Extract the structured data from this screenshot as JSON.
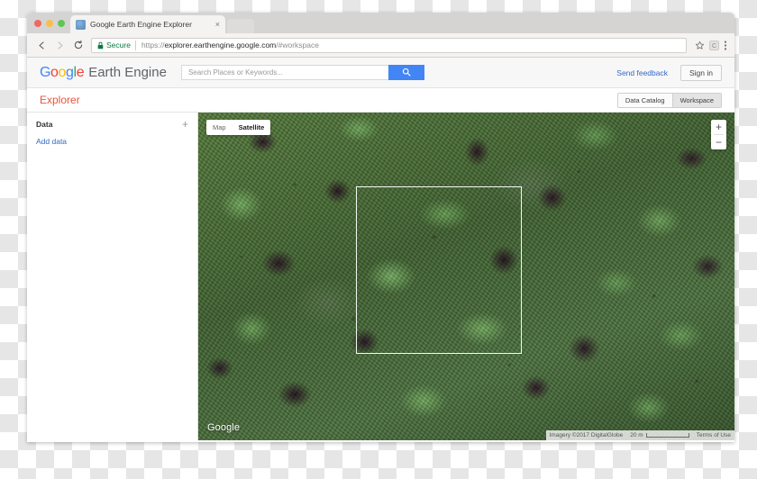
{
  "browser": {
    "tab": {
      "title": "Google Earth Engine Explorer",
      "close_label": "×",
      "favicon": "globe-favicon"
    },
    "nav": {
      "back": "back-arrow",
      "forward": "forward-arrow",
      "reload": "reload-arrow"
    },
    "omnibox": {
      "lock": "lock-icon",
      "secure_label": "Secure",
      "scheme": "https://",
      "host": "explorer.earthengine.google.com",
      "path": "/#workspace"
    },
    "actions": {
      "bookmark": "star-icon",
      "extension": "extension-icon",
      "menu": "three-dot-menu-icon"
    },
    "profile": "profile-avatar-icon"
  },
  "app": {
    "logo": {
      "g1": "G",
      "o1": "o",
      "o2": "o",
      "g2": "g",
      "l": "l",
      "e": "e"
    },
    "product_name": "Earth Engine",
    "search": {
      "placeholder": "Search Places or Keywords...",
      "value": "",
      "button_icon": "search-icon"
    },
    "send_feedback": "Send feedback",
    "sign_in": "Sign in",
    "explorer_title": "Explorer",
    "segments": [
      {
        "label": "Data Catalog",
        "active": false
      },
      {
        "label": "Workspace",
        "active": true
      }
    ]
  },
  "sidebar": {
    "data_label": "Data",
    "add_icon": "+",
    "add_data_link": "Add data"
  },
  "map": {
    "types": [
      {
        "label": "Map",
        "active": false
      },
      {
        "label": "Satellite",
        "active": true
      }
    ],
    "zoom_in": "+",
    "zoom_out": "−",
    "watermark": "Google",
    "attribution": "Imagery ©2017 DigitalGlobe",
    "scale_label": "20 m",
    "terms": "Terms of Use",
    "selection_box": "selection-rectangle"
  },
  "colors": {
    "google_blue": "#4285f4",
    "google_red": "#ea4335",
    "google_yellow": "#fbbc05",
    "google_green": "#34a853",
    "explorer_red": "#e8543f",
    "link_blue": "#3268c8",
    "secure_green": "#0a7a40"
  }
}
